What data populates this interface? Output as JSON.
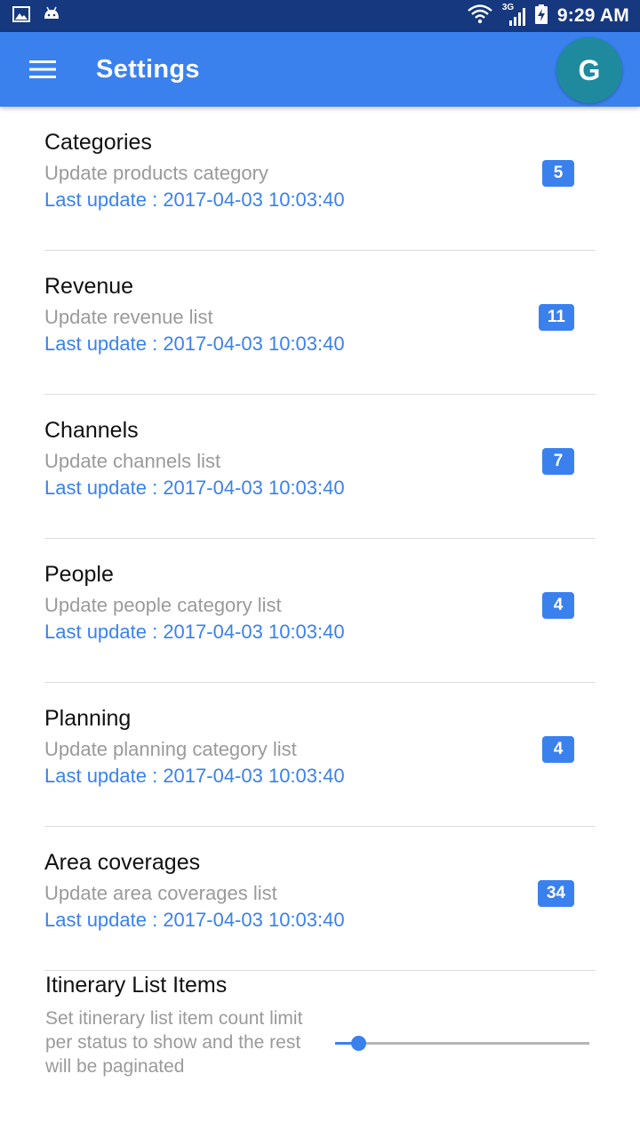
{
  "status_bar": {
    "time": "9:29 AM",
    "network": "3G",
    "icons": [
      "image-icon",
      "android-icon",
      "wifi-icon",
      "signal-icon",
      "battery-icon"
    ]
  },
  "app_bar": {
    "title": "Settings",
    "avatar_letter": "G",
    "menu_icon": "hamburger-menu-icon"
  },
  "colors": {
    "status_bar": "#16387f",
    "primary": "#3a81ee",
    "avatar": "#1f8a9e",
    "secondary_text": "#9a9a9a"
  },
  "settings": [
    {
      "title": "Categories",
      "subtitle": "Update products category",
      "last_update": "Last update : 2017-04-03 10:03:40",
      "count": "5"
    },
    {
      "title": "Revenue",
      "subtitle": "Update revenue list",
      "last_update": "Last update : 2017-04-03 10:03:40",
      "count": "11"
    },
    {
      "title": "Channels",
      "subtitle": "Update channels list",
      "last_update": "Last update : 2017-04-03 10:03:40",
      "count": "7"
    },
    {
      "title": "People",
      "subtitle": "Update people category list",
      "last_update": "Last update : 2017-04-03 10:03:40",
      "count": "4"
    },
    {
      "title": "Planning",
      "subtitle": "Update planning category list",
      "last_update": "Last update : 2017-04-03 10:03:40",
      "count": "4"
    },
    {
      "title": "Area coverages",
      "subtitle": "Update area coverages list",
      "last_update": "Last update : 2017-04-03 10:03:40",
      "count": "34"
    }
  ],
  "itinerary": {
    "title": "Itinerary List Items",
    "description": "Set itinerary list item count limit per status to show and the rest will be paginated",
    "slider_fraction": 0.09
  }
}
